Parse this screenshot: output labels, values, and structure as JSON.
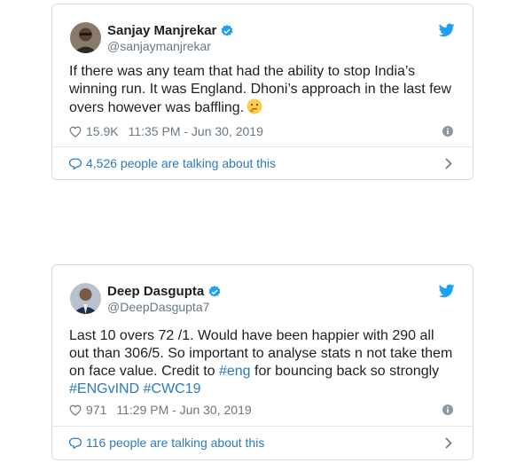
{
  "colors": {
    "link": "#2b7bb9",
    "verified": "#1da1f2",
    "muted": "#697882",
    "border": "#d7dde3"
  },
  "tweets": [
    {
      "author": {
        "name": "Sanjay Manjrekar",
        "handle": "@sanjaymanjrekar",
        "verified": true
      },
      "text": "If there was any team that had the ability to stop India’s winning run. It was England. Dhoni’s approach in the last few overs however was baffling.",
      "emoji": "thinking-face",
      "likes": "15.9K",
      "timestamp": "11:35 PM - Jun 30, 2019",
      "talking": "4,526 people are talking about this"
    },
    {
      "author": {
        "name": "Deep Dasgupta",
        "handle": "@DeepDasgupta7",
        "verified": true
      },
      "text_parts": {
        "before": "Last 10 overs 72 /1. Would have been happier with 290 all out than 306/5. So important to analyse stats n not take them on face value. Credit to ",
        "hashtag1": "#eng",
        "middle": " for bouncing back so strongly",
        "hashtag2": "#ENGvIND",
        "hashtag3": "#CWC19"
      },
      "likes": "971",
      "timestamp": "11:29 PM - Jun 30, 2019",
      "talking": "116 people are talking about this"
    }
  ]
}
